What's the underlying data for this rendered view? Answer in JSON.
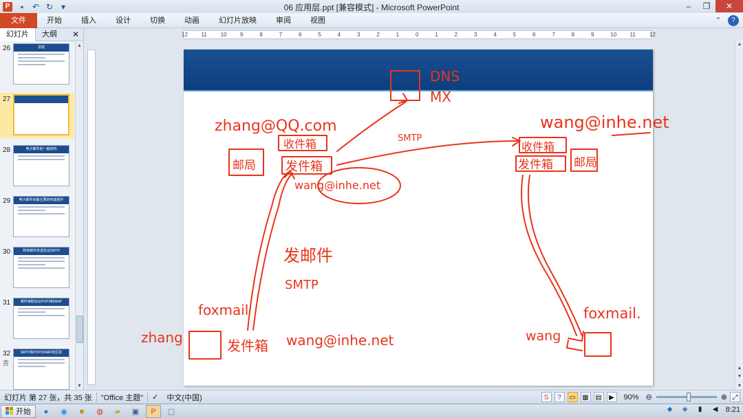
{
  "window": {
    "title": "06 应用层.ppt [兼容模式] - Microsoft PowerPoint",
    "app_icon": "P"
  },
  "ribbon": {
    "tabs": [
      "文件",
      "开始",
      "插入",
      "设计",
      "切换",
      "动画",
      "幻灯片放映",
      "审阅",
      "视图"
    ]
  },
  "left_panel": {
    "tabs": [
      "幻灯片",
      "大纲"
    ],
    "thumbnails": [
      {
        "num": "26",
        "title": "总结"
      },
      {
        "num": "27",
        "title": ""
      },
      {
        "num": "28",
        "title": "电子邮件的一般结构"
      },
      {
        "num": "29",
        "title": "电子邮件的最主要的构成组件"
      },
      {
        "num": "30",
        "title": "简单邮件传送协议SMTP"
      },
      {
        "num": "31",
        "title": "邮件读取协议POP3和IMAP"
      },
      {
        "num": "32",
        "title": "SMTP和POP3/IMAP的区别",
        "extra": "吉"
      }
    ]
  },
  "ruler": {
    "h_labels": [
      "12",
      "11",
      "10",
      "9",
      "8",
      "7",
      "6",
      "5",
      "4",
      "3",
      "2",
      "1",
      "0",
      "1",
      "2",
      "3",
      "4",
      "5",
      "6",
      "7",
      "8",
      "9",
      "10",
      "11",
      "12"
    ]
  },
  "ink": {
    "dns": "DNS",
    "mx": "MX",
    "email_sender": "zhang@QQ.com",
    "email_receiver": "wang@inhe.net",
    "inbox_left": "收件箱",
    "outbox_left": "发件箱",
    "mailbox_left": "邮局",
    "smtp_top": "SMTP",
    "inbox_right": "收件箱",
    "outbox_right": "发件箱",
    "mailbox_right": "邮局",
    "circled_addr": "wang@inhe.net",
    "send_mail": "发邮件",
    "smtp_mid": "SMTP",
    "formail_left": "foxmail",
    "zhang": "zhang",
    "outbox_bottom": "发件箱",
    "addr_bottom": "wang@inhe.net",
    "formail_right": "foxmail.",
    "wang": "wang"
  },
  "status": {
    "slide_info": "幻灯片 第 27 张，共 35 张",
    "theme": "\"Office 主题\"",
    "language": "中文(中国)",
    "zoom": "90%"
  },
  "taskbar": {
    "start": "开始",
    "clock": "8:21"
  },
  "colors": {
    "ink": "#e8341c",
    "slide_header": "#1a4f93",
    "file_tab": "#d24726"
  }
}
